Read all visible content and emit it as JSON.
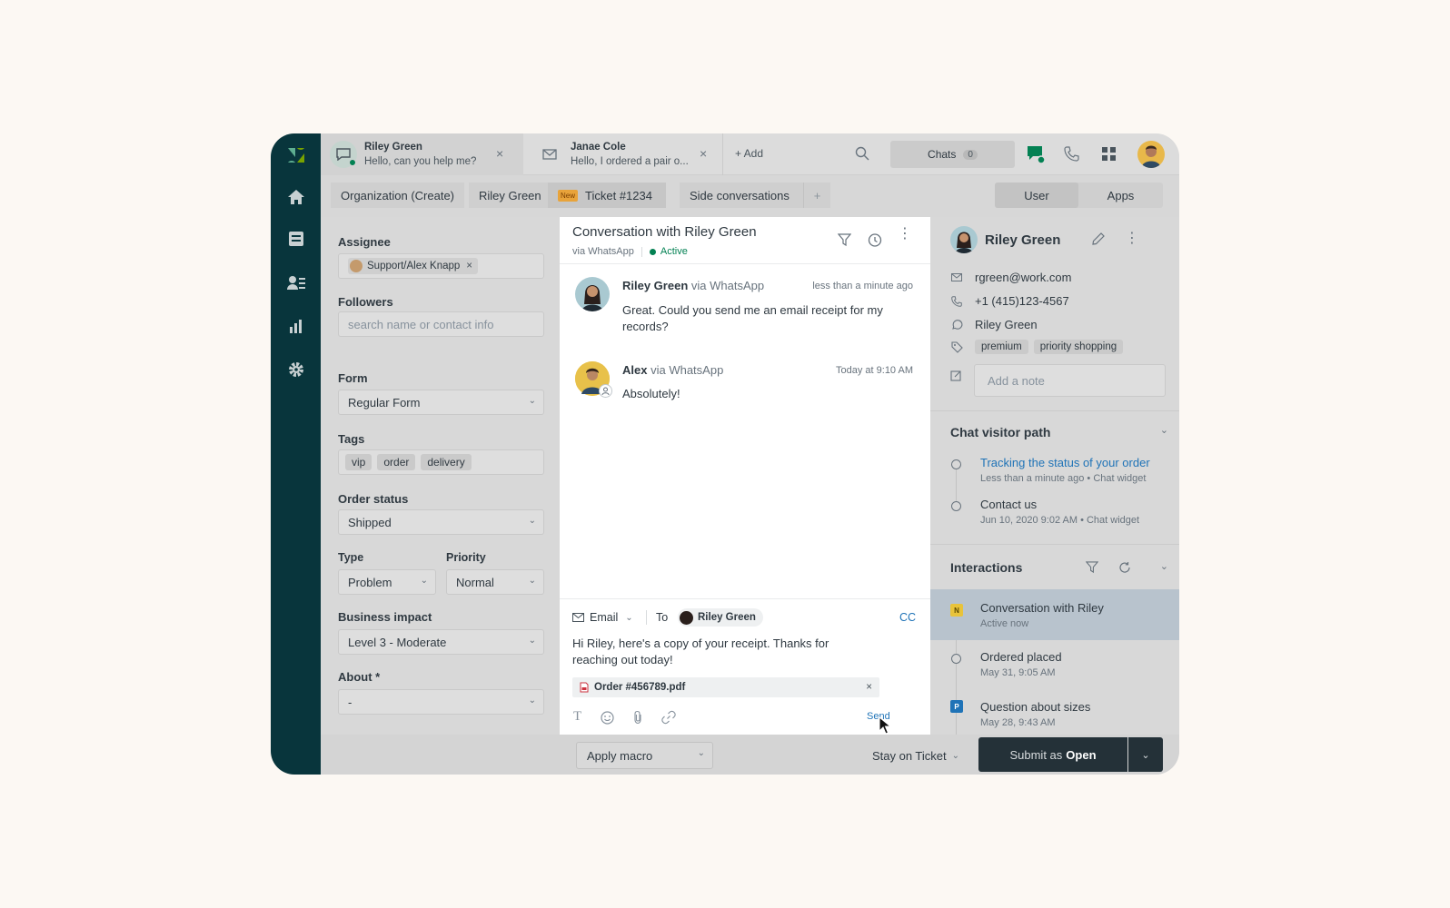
{
  "top_tabs": [
    {
      "name": "Riley Green",
      "preview": "Hello, can you help me?",
      "close": "×"
    },
    {
      "name": "Janae Cole",
      "preview": "Hello, I ordered a pair o...",
      "close": "×"
    }
  ],
  "top_actions": {
    "add_label": "+ Add",
    "chats_label": "Chats",
    "chats_count": "0"
  },
  "sub_tabs": [
    "Organization (Create)",
    "Riley Green",
    "Ticket #1234",
    "Side conversations",
    "+"
  ],
  "ticket_badge": "New",
  "right_tabs": [
    "User",
    "Apps"
  ],
  "form": {
    "assignee_label": "Assignee",
    "assignee_value": "Support/Alex Knapp",
    "assignee_remove": "×",
    "followers_label": "Followers",
    "followers_placeholder": "search name or contact info",
    "form_label": "Form",
    "form_value": "Regular Form",
    "tags_label": "Tags",
    "tags": [
      "vip",
      "order",
      "delivery"
    ],
    "order_status_label": "Order status",
    "order_status_value": "Shipped",
    "type_label": "Type",
    "type_value": "Problem",
    "priority_label": "Priority",
    "priority_value": "Normal",
    "impact_label": "Business impact",
    "impact_value": "Level 3 - Moderate",
    "about_label": "About *",
    "about_value": "-"
  },
  "conversation": {
    "title": "Conversation with Riley Green",
    "channel": "via WhatsApp",
    "status": "Active",
    "messages": [
      {
        "author": "Riley Green",
        "via": "via WhatsApp",
        "time": "less than a minute ago",
        "text": "Great. Could you send me an email receipt for my records?"
      },
      {
        "author": "Alex",
        "via": "via WhatsApp",
        "time": "Today at 9:10 AM",
        "text": "Absolutely!"
      }
    ]
  },
  "composer": {
    "channel": "Email",
    "to_label": "To",
    "recipient": "Riley Green",
    "cc": "CC",
    "body": "Hi Riley, here's a copy of your receipt. Thanks for reaching out today!",
    "attachment": "Order #456789.pdf",
    "attachment_remove": "×",
    "send": "Send"
  },
  "user": {
    "name": "Riley Green",
    "email": "rgreen@work.com",
    "phone": "+1 (415)123-4567",
    "whatsapp": "Riley Green",
    "tags": [
      "premium",
      "priority shopping"
    ],
    "note_placeholder": "Add a note"
  },
  "visitor_path": {
    "title": "Chat visitor path",
    "items": [
      {
        "title": "Tracking the status of your order",
        "meta": "Less than a minute ago • Chat widget"
      },
      {
        "title": "Contact us",
        "meta": "Jun 10, 2020 9:02 AM • Chat widget"
      }
    ]
  },
  "interactions": {
    "title": "Interactions",
    "items": [
      {
        "badge": "N",
        "title": "Conversation with Riley",
        "meta": "Active now"
      },
      {
        "badge": "",
        "title": "Ordered placed",
        "meta": "May 31, 9:05 AM"
      },
      {
        "badge": "P",
        "title": "Question about sizes",
        "meta": "May 28, 9:43 AM"
      }
    ]
  },
  "bottom": {
    "macro": "Apply macro",
    "stay": "Stay on Ticket",
    "submit_prefix": "Submit as",
    "submit_status": "Open"
  },
  "colors": {
    "nav": "#08353c",
    "submit": "#243138",
    "link": "#1f73b7",
    "active": "#038153"
  }
}
